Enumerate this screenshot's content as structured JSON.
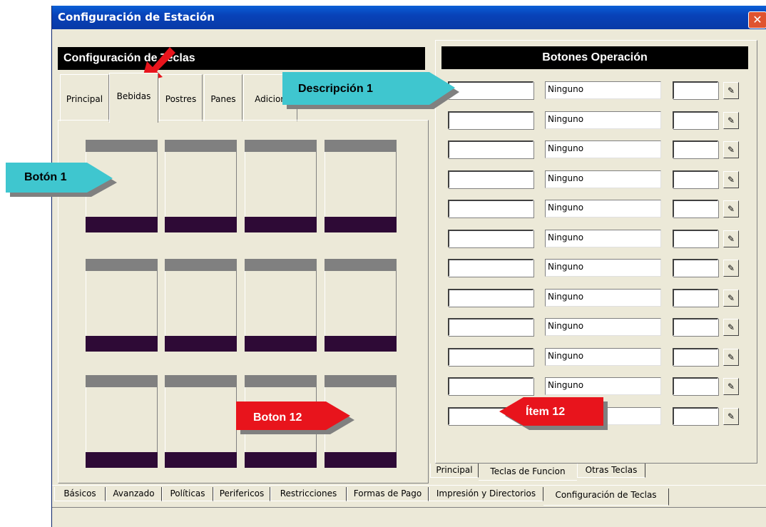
{
  "window": {
    "title": "Configuración de Estación",
    "close_glyph": "✕"
  },
  "left": {
    "header": "Configuración de Teclas",
    "tabs": [
      "Principal",
      "Bebidas",
      "Postres",
      "Panes",
      "Adicion"
    ]
  },
  "right": {
    "header": "Botones Operación",
    "rows": [
      "Ninguno",
      "Ninguno",
      "Ninguno",
      "Ninguno",
      "Ninguno",
      "Ninguno",
      "Ninguno",
      "Ninguno",
      "Ninguno",
      "Ninguno",
      "Ninguno",
      ""
    ],
    "row_button_glyph": "✎",
    "bottom_tabs": [
      "Principal",
      "Teclas de Funcion",
      "Otras Teclas"
    ]
  },
  "bottom_tabs": [
    "Básicos",
    "Avanzado",
    "Políticas",
    "Perifericos",
    "Restricciones",
    "Formas de Pago",
    "Impresión y Directorios",
    "Configuración de Teclas"
  ],
  "callouts": {
    "descripcion": "Descripción 1",
    "boton1": "Botón 1",
    "boton12": "Boton 12",
    "item12": "Ítem 12"
  },
  "colors": {
    "callout_teal": "#3fc6cf",
    "callout_red": "#e8141c",
    "title_blue": "#0842b8"
  }
}
